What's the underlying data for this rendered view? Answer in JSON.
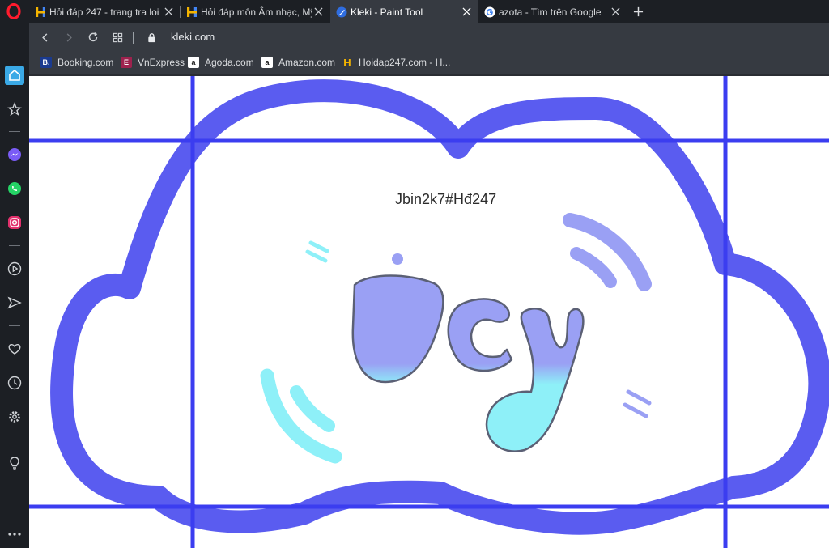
{
  "tabs": [
    {
      "title": "Hỏi đáp 247 - trang tra loi",
      "favicon": "hoidap-h-icon",
      "active": false
    },
    {
      "title": "Hỏi đáp môn Âm nhạc, Mỹ",
      "favicon": "hoidap-h-icon",
      "active": false
    },
    {
      "title": "Kleki - Paint Tool",
      "favicon": "kleki-icon",
      "active": true
    },
    {
      "title": "azota - Tìm trên Google",
      "favicon": "google-g-icon",
      "active": false
    }
  ],
  "toolbar": {
    "url": "kleki.com"
  },
  "bookmarks": [
    {
      "label": "Booking.com",
      "icon_text": "B.",
      "color": "#1a3a8f"
    },
    {
      "label": "VnExpress",
      "icon_text": "E",
      "color": "#9f224e"
    },
    {
      "label": "Agoda.com",
      "icon_text": "a",
      "color": "#ffffff"
    },
    {
      "label": "Amazon.com",
      "icon_text": "a",
      "color": "#ffffff"
    },
    {
      "label": "Hoidap247.com - H...",
      "icon_text": "H",
      "color": "#f4b400"
    }
  ],
  "canvas": {
    "watermark_text": "Jbin2k7#Hđ247",
    "cloud_color": "#5a5cf0",
    "grid_color": "#3b3df0",
    "accent_light": "#9aa0f4",
    "accent_cyan": "#8ef0f8"
  },
  "sidebar": {
    "accent": "#3aa9e6",
    "icons": [
      "home-icon",
      "star-icon",
      "messenger-icon",
      "whatsapp-icon",
      "instagram-icon",
      "player-icon",
      "send-icon",
      "heart-icon",
      "history-icon",
      "settings-icon",
      "lightbulb-icon",
      "more-icon"
    ]
  }
}
